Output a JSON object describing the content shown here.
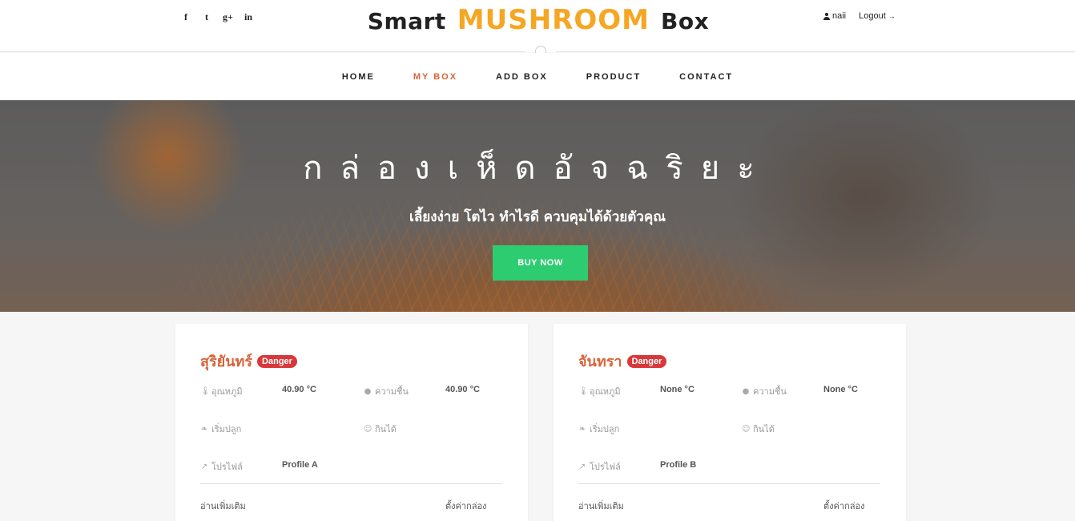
{
  "header": {
    "social": [
      {
        "icon": "facebook-icon",
        "glyph": "f"
      },
      {
        "icon": "twitter-icon",
        "glyph": "t"
      },
      {
        "icon": "google-plus-icon",
        "glyph": "g+"
      },
      {
        "icon": "linkedin-icon",
        "glyph": "in"
      }
    ],
    "logo": {
      "word1": "Smart",
      "word2": "MUSHROOM",
      "word3": "Box"
    },
    "user": {
      "name": "naii",
      "logout": "Logout"
    }
  },
  "nav": {
    "items": [
      "HOME",
      "MY BOX",
      "ADD BOX",
      "PRODUCT",
      "CONTACT"
    ],
    "active": "MY BOX"
  },
  "hero": {
    "title": "กล่องเห็ดอัจฉริยะ",
    "subtitle": "เลี้ยงง่าย โตไว ทำไรดี ควบคุมได้ด้วยตัวคุณ",
    "button": "BUY NOW"
  },
  "labels": {
    "temperature": "อุณหภูมิ",
    "humidity": "ความชื้น",
    "start": "เริ่มปลูก",
    "harvest": "กินได้",
    "profile": "โปรไฟล์",
    "read_more": "อ่านเพิ่มเติม",
    "settings": "ตั้งค่ากล่อง"
  },
  "boxes": [
    {
      "name": "สุริยันทร์",
      "status": "Danger",
      "temperature": "40.90 °C",
      "humidity": "40.90 °C",
      "start": "",
      "harvest": "",
      "profile": "Profile A"
    },
    {
      "name": "จันทรา",
      "status": "Danger",
      "temperature": "None °C",
      "humidity": "None °C",
      "start": "",
      "harvest": "",
      "profile": "Profile B"
    }
  ],
  "colors": {
    "accent": "#d7643a",
    "logo_accent": "#f5a623",
    "button": "#2ecc71",
    "badge": "#d9383a"
  }
}
